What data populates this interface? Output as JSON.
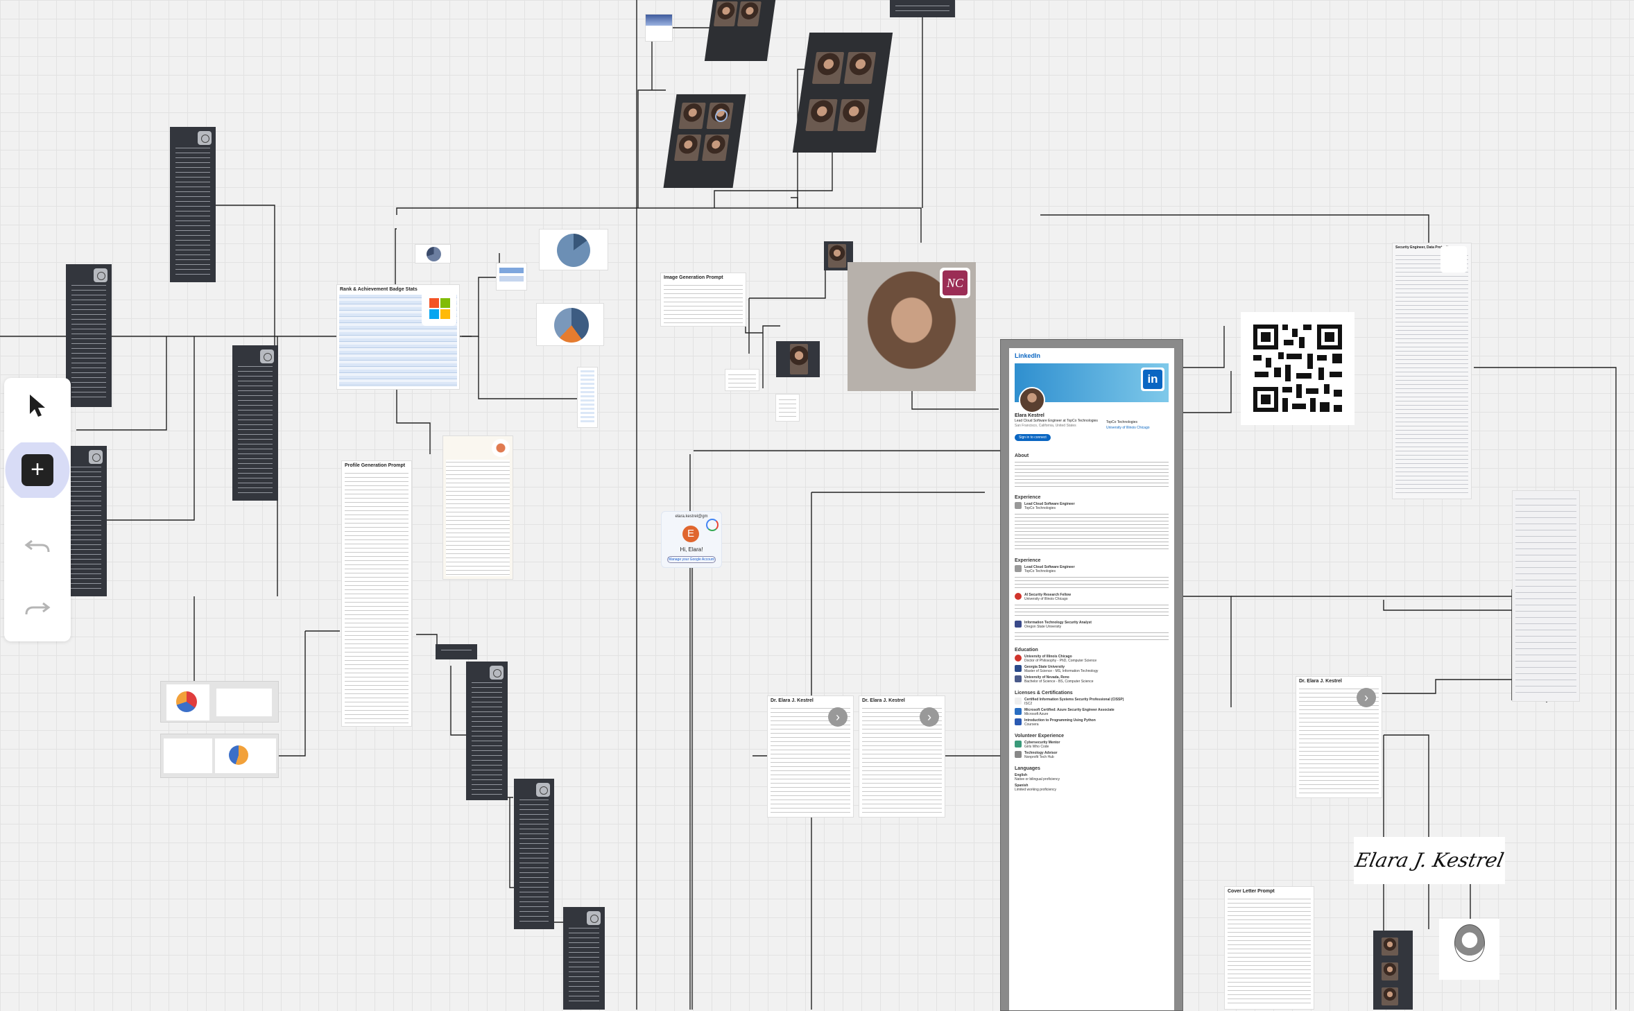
{
  "toolbar": {
    "select_icon": "cursor-arrow-icon",
    "add_icon": "plus-icon",
    "undo_icon": "undo-icon",
    "redo_icon": "redo-icon",
    "accent": "#d8dcf6"
  },
  "nodes": {
    "stats_table_title": "Rank & Achievement Badge Stats",
    "profile_prompt_title": "Profile Generation Prompt",
    "image_prompt_title": "Image Generation Prompt",
    "cover_letter_title": "Cover Letter Prompt",
    "resume_name_1": "Dr. Elara J. Kestrel",
    "resume_name_2": "Dr. Elara J. Kestrel",
    "resume_name_3": "Dr. Elara J. Kestrel",
    "google_greeting": "Hi, Elara!",
    "google_avatar_letter": "E",
    "google_manage": "Manage your Google Account",
    "google_email": "elara.kestrel@gm",
    "logo_nc": "NC",
    "signature": "Elara J. Kestrel",
    "ms_colors": [
      "#f35325",
      "#81bc06",
      "#05a6f0",
      "#ffba08"
    ]
  },
  "linkedin": {
    "brand": "LinkedIn",
    "name": "Elara Kestrel",
    "headline": "Lead Cloud Software Engineer at TopCo Technologies",
    "location": "San Francisco, California, United States",
    "employer": "TopCo Technologies",
    "school": "University of Illinois Chicago",
    "connect": "Sign in to connect",
    "about_h": "About",
    "experience_h": "Experience",
    "education_h": "Education",
    "licenses_h": "Licenses & Certifications",
    "volunteer_h": "Volunteer Experience",
    "languages_h": "Languages",
    "exp": [
      {
        "title": "Lead Cloud Software Engineer",
        "org": "TopCo Technologies"
      },
      {
        "title": "AI Security Research Fellow",
        "org": "University of Illinois Chicago"
      },
      {
        "title": "Information Technology Security Analyst",
        "org": "Oregon State University"
      }
    ],
    "edu": [
      {
        "title": "University of Illinois Chicago",
        "org": "Doctor of Philosophy - PhD, Computer Science"
      },
      {
        "title": "Georgia State University",
        "org": "Master of Science - MS, Information Technology"
      },
      {
        "title": "University of Nevada, Reno",
        "org": "Bachelor of Science - BS, Computer Science"
      }
    ],
    "certs": [
      {
        "title": "Certified Information Systems Security Professional (CISSP)",
        "org": "ISC2"
      },
      {
        "title": "Microsoft Certified: Azure Security Engineer Associate",
        "org": "Microsoft Azure"
      },
      {
        "title": "Introduction to Programming Using Python",
        "org": "Coursera"
      }
    ],
    "volunteer": [
      {
        "title": "Cybersecurity Mentor",
        "org": "Girls Who Code"
      },
      {
        "title": "Technology Advisor",
        "org": "Nonprofit Tech Hub"
      }
    ],
    "languages": [
      {
        "title": "English",
        "org": "Native or bilingual proficiency"
      },
      {
        "title": "Spanish",
        "org": "Limited working proficiency"
      }
    ]
  },
  "document": {
    "title": "Security Engineer, Data Protection"
  }
}
